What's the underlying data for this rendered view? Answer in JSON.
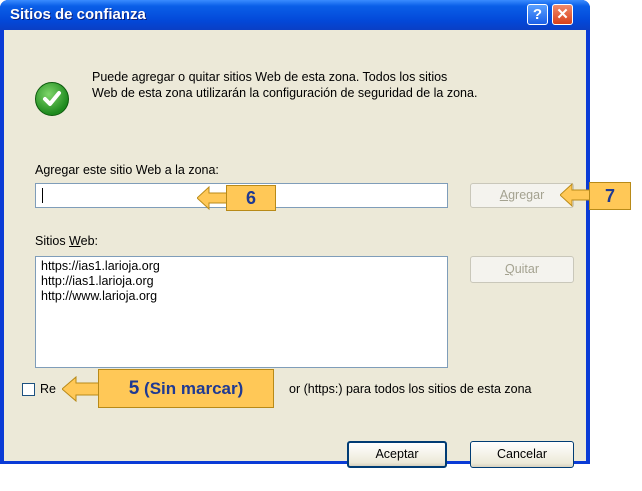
{
  "window": {
    "title": "Sitios de confianza",
    "help_label": "?",
    "close_label": "✕"
  },
  "description": {
    "line1": "Puede agregar o quitar sitios Web de esta zona.  Todos los sitios",
    "line2": "Web de esta zona utilizarán la configuración de seguridad de la zona."
  },
  "add_label": {
    "pre": "Agre",
    "underlined": "g",
    "post": "ar este sitio Web a la zona:"
  },
  "add_input": {
    "value": ""
  },
  "add_button": {
    "pre": "",
    "underlined": "A",
    "post": "gregar"
  },
  "sites_label": {
    "pre": "Sitios ",
    "underlined": "W",
    "post": "eb:"
  },
  "sites": [
    "https://ias1.larioja.org",
    "http://ias1.larioja.org",
    "http://www.larioja.org"
  ],
  "remove_button": {
    "pre": "",
    "underlined": "Q",
    "post": "uitar"
  },
  "checkbox": {
    "label_left": "Re",
    "label_right": "or (https:) para todos los sitios de esta zona",
    "checked": false
  },
  "ok_button": "Aceptar",
  "cancel_button": "Cancelar",
  "callouts": {
    "c6": "6",
    "c7": "7",
    "c5_number": "5",
    "c5_text": "(Sin marcar)"
  },
  "colors": {
    "callout_fill": "#ffc857",
    "callout_text": "#1f3a93",
    "titlebar": "#0348d8"
  },
  "icons": {
    "status": "green-check-icon",
    "arrow": "left-arrow-icon"
  }
}
